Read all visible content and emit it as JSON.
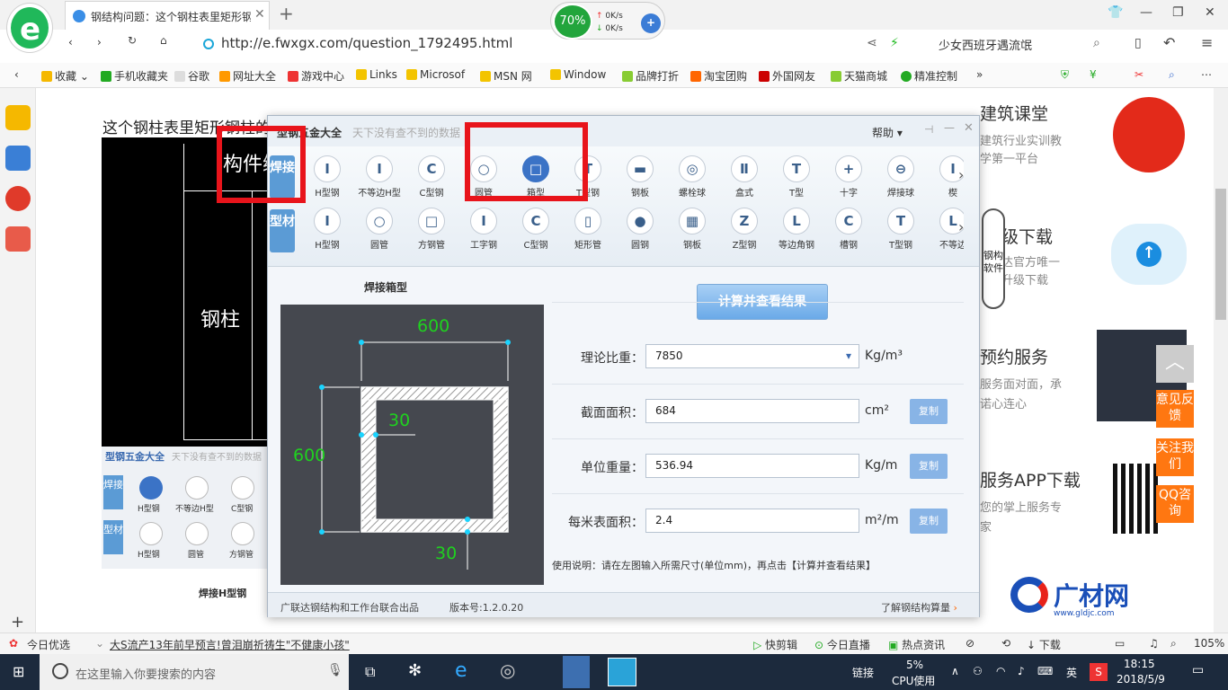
{
  "browser": {
    "tab_title": "钢结构问题：这个钢柱表里矩形钢",
    "tab_close": "✕",
    "new_tab": "+",
    "speed_percent": "70%",
    "speed_up": "0K/s",
    "speed_down": "0K/s",
    "url": "http://e.fwxgx.com/question_1792495.html",
    "search_text": "少女西班牙遇流氓",
    "bookmarks": [
      "收藏",
      "手机收藏夹",
      "谷歌",
      "网址大全",
      "游戏中心",
      "Links",
      "Microsof",
      "MSN 网",
      "Window",
      "品牌打折",
      "淘宝团购",
      "外国网友",
      "天猫商城",
      "精准控制"
    ],
    "bookmark_more": "»"
  },
  "page": {
    "title": "这个钢柱表里矩形钢柱的",
    "cad_text_1": "构件编",
    "cad_text_2": "钢柱",
    "small_app": {
      "title": "型钢五金大全",
      "subtitle": "天下没有查不到的数据",
      "cat1": "焊接",
      "cat2": "型材",
      "row1": [
        "H型钢",
        "不等边H型",
        "C型钢"
      ],
      "row2": [
        "H型钢",
        "圆管",
        "方钢管"
      ],
      "section": "焊接H型钢"
    },
    "right": {
      "card1_title": "建筑课堂",
      "card1_sub1": "建筑行业实训教",
      "card1_sub2": "学第一平台",
      "card2_title": "级下载",
      "card2_sub1": "达官方唯一",
      "card2_sub2": "升级下载",
      "card3_title": "预约服务",
      "card3_sub1": "服务面对面，承",
      "card3_sub2": "诺心连心",
      "card4_title": "服务APP下载",
      "card4_sub1": "您的掌上服务专",
      "card4_sub2": "家",
      "mascot": "钢构软件",
      "brand": "广材网",
      "brand_url": "www.gldjc.com",
      "feedback": "意见反馈",
      "follow": "关注我们",
      "qq": "QQ咨询"
    }
  },
  "dialog": {
    "title": "型钢五金大全",
    "subtitle": "天下没有查不到的数据",
    "help": "帮助",
    "cat_weld": "焊接",
    "cat_profile": "型材",
    "row1": [
      {
        "label": "H型钢",
        "icon": "I"
      },
      {
        "label": "不等边H型",
        "icon": "I"
      },
      {
        "label": "C型钢",
        "icon": "C"
      },
      {
        "label": "圆管",
        "icon": "○"
      },
      {
        "label": "箱型",
        "icon": "□"
      },
      {
        "label": "T型钢",
        "icon": "T"
      },
      {
        "label": "钢板",
        "icon": "▬"
      },
      {
        "label": "螺栓球",
        "icon": "◎"
      },
      {
        "label": "盒式",
        "icon": "Ⅱ"
      },
      {
        "label": "T型",
        "icon": "T"
      },
      {
        "label": "十字",
        "icon": "+"
      },
      {
        "label": "焊接球",
        "icon": "⊖"
      },
      {
        "label": "楔",
        "icon": "I"
      }
    ],
    "row2": [
      {
        "label": "H型钢",
        "icon": "I"
      },
      {
        "label": "圆管",
        "icon": "○"
      },
      {
        "label": "方钢管",
        "icon": "□"
      },
      {
        "label": "工字钢",
        "icon": "I"
      },
      {
        "label": "C型钢",
        "icon": "C"
      },
      {
        "label": "矩形管",
        "icon": "▯"
      },
      {
        "label": "圆钢",
        "icon": "●"
      },
      {
        "label": "钢板",
        "icon": "▦"
      },
      {
        "label": "Z型钢",
        "icon": "Z"
      },
      {
        "label": "等边角钢",
        "icon": "L"
      },
      {
        "label": "槽钢",
        "icon": "C"
      },
      {
        "label": "T型钢",
        "icon": "T"
      },
      {
        "label": "不等边",
        "icon": "L"
      }
    ],
    "preview_title": "焊接箱型",
    "dim_width": "600",
    "dim_height": "600",
    "dim_web": "30",
    "dim_flange": "30",
    "calc_button": "计算并查看结果",
    "fields": {
      "density_label": "理论比重：",
      "density_value": "7850",
      "density_unit": "Kg/m³",
      "area_label": "截面面积：",
      "area_value": "684",
      "area_unit": "cm²",
      "weight_label": "单位重量：",
      "weight_value": "536.94",
      "weight_unit": "Kg/m",
      "surface_label": "每米表面积：",
      "surface_value": "2.4",
      "surface_unit": "m²/m",
      "copy": "复制"
    },
    "note": "使用说明：请在左图输入所需尺寸(单位mm)，再点击【计算并查看结果】",
    "footer_credit": "广联达钢结构和工作台联合出品",
    "footer_version": "版本号:1.2.0.20",
    "footer_link": "了解钢结构算量"
  },
  "statusbar": {
    "left1": "今日优选",
    "news": "大S流产13年前早预言!曾泪崩祈祷生\"不健康小孩\"",
    "items": [
      "快剪辑",
      "今日直播",
      "热点资讯",
      "下载"
    ],
    "zoom": "105%"
  },
  "taskbar": {
    "search_placeholder": "在这里输入你要搜索的内容",
    "network": "链接",
    "cpu_pct": "5%",
    "cpu_label": "CPU使用",
    "ime": "英",
    "time": "18:15",
    "date": "2018/5/9"
  }
}
